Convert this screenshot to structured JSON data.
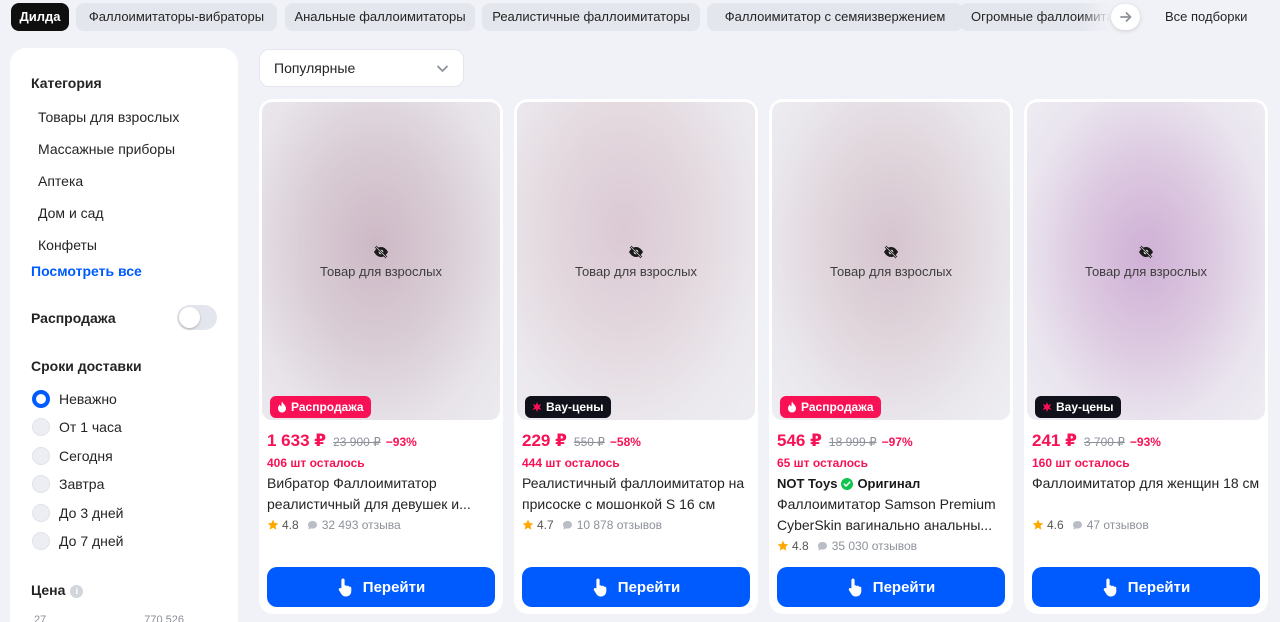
{
  "chips": [
    {
      "label": "Дилда",
      "active": true
    },
    {
      "label": "Фаллоимитаторы-вибраторы"
    },
    {
      "label": "Анальные фаллоимитаторы"
    },
    {
      "label": "Реалистичные фаллоимитаторы"
    },
    {
      "label": "Фаллоимитатор с семяизвержением"
    },
    {
      "label": "Огромные фаллоимитаторы"
    }
  ],
  "all_collections": "Все подборки",
  "sidebar": {
    "category_heading": "Категория",
    "categories": [
      "Товары для взрослых",
      "Массажные приборы",
      "Аптека",
      "Дом и сад",
      "Конфеты"
    ],
    "see_all": "Посмотреть все",
    "sale_label": "Распродажа",
    "delivery_heading": "Сроки доставки",
    "delivery_options": [
      "Неважно",
      "От 1 часа",
      "Сегодня",
      "Завтра",
      "До 3 дней",
      "До 7 дней"
    ],
    "delivery_selected": "Неважно",
    "price_heading": "Цена",
    "price_min": "27",
    "price_max": "770 526"
  },
  "sort": {
    "value": "Популярные"
  },
  "adult_label": "Товар для взрослых",
  "button_label": "Перейти",
  "products": [
    {
      "badge": "Распродажа",
      "badge_type": "sale",
      "price": "1 633 ₽",
      "old_price": "23 900 ₽",
      "discount": "−93%",
      "left": "406 шт осталось",
      "title": "Вибратор Фаллоимитатор реалистичный для девушек и...",
      "rating": "4.8",
      "reviews": "32 493 отзыва"
    },
    {
      "badge": "Вау-цены",
      "badge_type": "wow",
      "price": "229 ₽",
      "old_price": "550 ₽",
      "discount": "−58%",
      "left": "444 шт осталось",
      "title": "Реалистичный фаллоимитатор на присоске с мошонкой S 16 см",
      "rating": "4.7",
      "reviews": "10 878 отзывов"
    },
    {
      "badge": "Распродажа",
      "badge_type": "sale",
      "price": "546 ₽",
      "old_price": "18 999 ₽",
      "discount": "−97%",
      "left": "65 шт осталось",
      "brand": "NOT Toys",
      "original_label": "Оригинал",
      "title": "Фаллоимитатор Samson Premium CyberSkin вагинально анальны...",
      "rating": "4.8",
      "reviews": "35 030 отзывов"
    },
    {
      "badge": "Вау-цены",
      "badge_type": "wow",
      "price": "241 ₽",
      "old_price": "3 700 ₽",
      "discount": "−93%",
      "left": "160 шт осталось",
      "title": "Фаллоимитатор для женщин 18 см",
      "rating": "4.6",
      "reviews": "47 отзывов"
    }
  ],
  "colors": {
    "accent": "#005bff",
    "sale_pink": "#f91155",
    "wow_black": "#10111a",
    "star": "#ffa800",
    "verified_green": "#10c44c"
  },
  "icons": {
    "chip_next": "arrow-right-icon",
    "sort_caret": "chevron-down-icon",
    "adult": "eye-off-icon",
    "sale_badge": "flame-icon",
    "wow_badge": "star-burst-icon",
    "rating": "star-icon",
    "reviews": "chat-bubble-icon",
    "verified": "check-circle-icon",
    "button": "pointing-hand-icon",
    "price_info": "info-icon"
  }
}
